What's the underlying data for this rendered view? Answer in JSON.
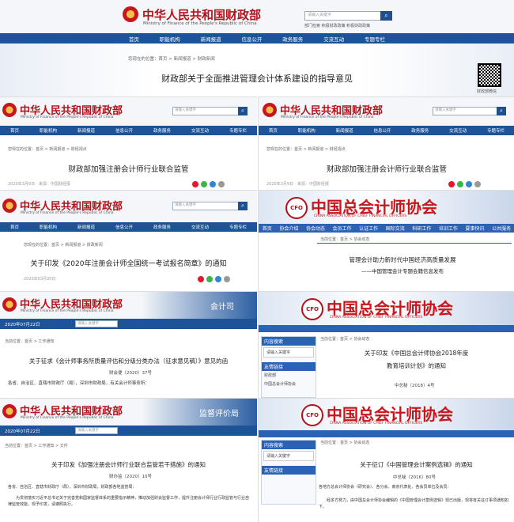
{
  "mof": {
    "name_cn": "中华人民共和国财政部",
    "name_en": "Ministry of Finance of the People's Republic of China",
    "search_placeholder": "请输入关键字",
    "quick_links": "部门检索  积极财政政策  积极财政政策",
    "nav": [
      "首页",
      "职能机构",
      "新闻报道",
      "信息公开",
      "政务服务",
      "交流互动",
      "专题专栏"
    ],
    "crumb_p1": "您现在的位置：首页 > 新闻报道 > 财政新闻",
    "crumb_p2": "您现在的位置：首页 > 新闻报道 > 财经视点",
    "crumb_p4": "您现在的位置：首页 > 新闻报道 > 财政新闻",
    "crumb_p7": "当前位置：首页 > 工作通知",
    "crumb_p9": "当前位置：首页 > 工作通知 > 文件",
    "share": [
      "weibo-icon",
      "wechat-icon",
      "qq-icon",
      "share-icon"
    ],
    "qr_label": "财政部微信"
  },
  "p1": {
    "title": "财政部关于全面推进管理会计体系建设的指导意见"
  },
  "p2": {
    "title": "财政部加强注册会计师行业联合监管",
    "meta": "2020年3月9日 · 来源：中国财经报"
  },
  "p3": {
    "title": "财政部加强注册会计师行业联合监管",
    "meta": "2020年3月9日 · 来源：中国财经报"
  },
  "p4": {
    "title": "关于印发《2020年注册会计师全国统一考试报名简章》的通知",
    "meta": "2020年03月20日"
  },
  "p5": {
    "name_cn": "中国总会计师协会",
    "name_en": "CHINA ASSOCIATION OF CHIEF FINANCIAL OFFICERS",
    "nav": [
      "首页",
      "协会介绍",
      "协会动态",
      "会员工作",
      "认证工作",
      "国际交流",
      "科研工作",
      "培训工作",
      "要事快讯",
      "公共服务"
    ],
    "crumb": "当前位置：首页 > 协会动态",
    "title1": "管理会计助力新时代中国经济高质量发展",
    "title2": "——中国管理会计专题会籍信息发布"
  },
  "p6": {
    "dept": "会计司",
    "date": "2020年07月22日",
    "title": "关于征求《会计师事务所质量评估和分级分类办法（征求意见稿）》意见的函",
    "doc_no": "财会便〔2020〕37号",
    "body": "各省、自治区、直辖市财政厅（局），深圳市财政局，有关会计师事务所："
  },
  "p7": {
    "crumb": "当前位置：首页 > 协会动态",
    "side_h1": "内容搜索",
    "side_h2": "友情链接",
    "side_link1": "财政部",
    "side_link2": "中国总会计师协会",
    "title1": "关于印发《中国总会计师协会2018年度",
    "title2": "教育培训计划》的通知",
    "doc_no": "中总秘〔2018〕4号"
  },
  "p8": {
    "dept": "监督评价局",
    "date": "2020年07月22日",
    "title": "关于印发《加强注册会计师行业联合监管若干措施》的通知",
    "doc_no": "财办监〔2020〕10号",
    "body1": "各省、自治区、直辖市财政厅（局），深圳市财政局，财政部各地监管局：",
    "body2": "为贯彻落实习近平总书记关于完善党和国家监督体系的重要指示精神，推动加强财会监督工作，提升注册会计师行业行政监管与行业自律监管效能，现予印发，请遵照执行。"
  },
  "p9": {
    "crumb": "当前位置：首页 > 协会动态",
    "side_h1": "内容搜索",
    "side_h2": "友情链接",
    "title": "关于征订《中国管理会计案例选辑》的通知",
    "doc_no": "中总秘〔2016〕80号",
    "body1": "各地方总会计师协会（研究会）、各分会、南京代表处、各会员单位及会员：",
    "body2": "经多方努力，由中国总会计师协会编辑的《中国管理会计案例选辑》现已出版，现将有关征订事项通知如下。"
  },
  "colors": {
    "mof_red": "#b3121a",
    "mof_blue": "#1e5397",
    "cfo_blue": "#2a62b5"
  }
}
